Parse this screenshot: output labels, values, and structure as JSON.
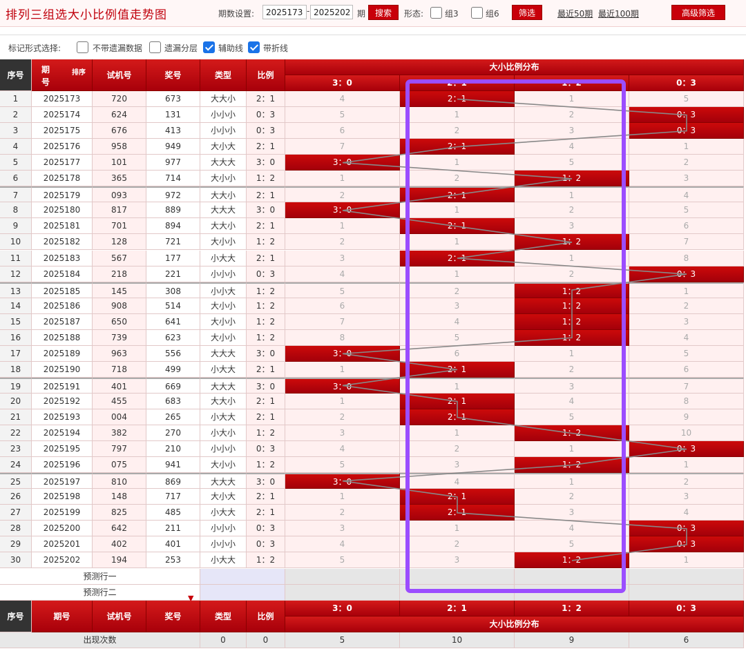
{
  "title": "排列三组选大小比例值走势图",
  "controls": {
    "period_label": "期数设置:",
    "start_value": "2025173",
    "dash": "-",
    "end_value": "2025202",
    "period_suffix": "期",
    "search_label": "搜索",
    "form_label": "形态:",
    "group3_label": "组3",
    "group6_label": "组6",
    "filter_label": "筛选",
    "recent50_label": "最近50期",
    "recent100_label": "最近100期",
    "advanced_label": "高级筛选"
  },
  "options": {
    "label": "标记形式选择:",
    "items": [
      {
        "label": "不带遗漏数据",
        "checked": false
      },
      {
        "label": "遗漏分层",
        "checked": false
      },
      {
        "label": "辅助线",
        "checked": true
      },
      {
        "label": "带折线",
        "checked": true
      }
    ]
  },
  "header": {
    "seq": "序号",
    "period_top": "期",
    "period_bottom": "号",
    "sort": "排序",
    "test": "试机号",
    "prize": "奖号",
    "type": "类型",
    "ratio": "比例",
    "dist_title": "大小比例分布",
    "dist_cols": [
      "3：0",
      "2：1",
      "1：2",
      "0：3"
    ]
  },
  "rows": [
    {
      "seq": "1",
      "period": "2025173",
      "test": "720",
      "prize": "673",
      "type": "大大小",
      "ratio": "2：1",
      "cells": [
        "4",
        "2：1",
        "1",
        "5"
      ],
      "hit": 1
    },
    {
      "seq": "2",
      "period": "2025174",
      "test": "624",
      "prize": "131",
      "type": "小小小",
      "ratio": "0：3",
      "cells": [
        "5",
        "1",
        "2",
        "0：3"
      ],
      "hit": 3
    },
    {
      "seq": "3",
      "period": "2025175",
      "test": "676",
      "prize": "413",
      "type": "小小小",
      "ratio": "0：3",
      "cells": [
        "6",
        "2",
        "3",
        "0：3"
      ],
      "hit": 3
    },
    {
      "seq": "4",
      "period": "2025176",
      "test": "958",
      "prize": "949",
      "type": "大小大",
      "ratio": "2：1",
      "cells": [
        "7",
        "2：1",
        "4",
        "1"
      ],
      "hit": 1
    },
    {
      "seq": "5",
      "period": "2025177",
      "test": "101",
      "prize": "977",
      "type": "大大大",
      "ratio": "3：0",
      "cells": [
        "3：0",
        "1",
        "5",
        "2"
      ],
      "hit": 0
    },
    {
      "seq": "6",
      "period": "2025178",
      "test": "365",
      "prize": "714",
      "type": "大小小",
      "ratio": "1：2",
      "cells": [
        "1",
        "2",
        "1：2",
        "3"
      ],
      "hit": 2
    },
    {
      "seq": "7",
      "period": "2025179",
      "test": "093",
      "prize": "972",
      "type": "大大小",
      "ratio": "2：1",
      "cells": [
        "2",
        "2：1",
        "1",
        "4"
      ],
      "hit": 1
    },
    {
      "seq": "8",
      "period": "2025180",
      "test": "817",
      "prize": "889",
      "type": "大大大",
      "ratio": "3：0",
      "cells": [
        "3：0",
        "1",
        "2",
        "5"
      ],
      "hit": 0
    },
    {
      "seq": "9",
      "period": "2025181",
      "test": "701",
      "prize": "894",
      "type": "大大小",
      "ratio": "2：1",
      "cells": [
        "1",
        "2：1",
        "3",
        "6"
      ],
      "hit": 1
    },
    {
      "seq": "10",
      "period": "2025182",
      "test": "128",
      "prize": "721",
      "type": "大小小",
      "ratio": "1：2",
      "cells": [
        "2",
        "1",
        "1：2",
        "7"
      ],
      "hit": 2
    },
    {
      "seq": "11",
      "period": "2025183",
      "test": "567",
      "prize": "177",
      "type": "小大大",
      "ratio": "2：1",
      "cells": [
        "3",
        "2：1",
        "1",
        "8"
      ],
      "hit": 1
    },
    {
      "seq": "12",
      "period": "2025184",
      "test": "218",
      "prize": "221",
      "type": "小小小",
      "ratio": "0：3",
      "cells": [
        "4",
        "1",
        "2",
        "0：3"
      ],
      "hit": 3
    },
    {
      "seq": "13",
      "period": "2025185",
      "test": "145",
      "prize": "308",
      "type": "小小大",
      "ratio": "1：2",
      "cells": [
        "5",
        "2",
        "1：2",
        "1"
      ],
      "hit": 2
    },
    {
      "seq": "14",
      "period": "2025186",
      "test": "908",
      "prize": "514",
      "type": "大小小",
      "ratio": "1：2",
      "cells": [
        "6",
        "3",
        "1：2",
        "2"
      ],
      "hit": 2
    },
    {
      "seq": "15",
      "period": "2025187",
      "test": "650",
      "prize": "641",
      "type": "大小小",
      "ratio": "1：2",
      "cells": [
        "7",
        "4",
        "1：2",
        "3"
      ],
      "hit": 2
    },
    {
      "seq": "16",
      "period": "2025188",
      "test": "739",
      "prize": "623",
      "type": "大小小",
      "ratio": "1：2",
      "cells": [
        "8",
        "5",
        "1：2",
        "4"
      ],
      "hit": 2
    },
    {
      "seq": "17",
      "period": "2025189",
      "test": "963",
      "prize": "556",
      "type": "大大大",
      "ratio": "3：0",
      "cells": [
        "3：0",
        "6",
        "1",
        "5"
      ],
      "hit": 0
    },
    {
      "seq": "18",
      "period": "2025190",
      "test": "718",
      "prize": "499",
      "type": "小大大",
      "ratio": "2：1",
      "cells": [
        "1",
        "2：1",
        "2",
        "6"
      ],
      "hit": 1
    },
    {
      "seq": "19",
      "period": "2025191",
      "test": "401",
      "prize": "669",
      "type": "大大大",
      "ratio": "3：0",
      "cells": [
        "3：0",
        "1",
        "3",
        "7"
      ],
      "hit": 0
    },
    {
      "seq": "20",
      "period": "2025192",
      "test": "455",
      "prize": "683",
      "type": "大大小",
      "ratio": "2：1",
      "cells": [
        "1",
        "2：1",
        "4",
        "8"
      ],
      "hit": 1
    },
    {
      "seq": "21",
      "period": "2025193",
      "test": "004",
      "prize": "265",
      "type": "小大大",
      "ratio": "2：1",
      "cells": [
        "2",
        "2：1",
        "5",
        "9"
      ],
      "hit": 1
    },
    {
      "seq": "22",
      "period": "2025194",
      "test": "382",
      "prize": "270",
      "type": "小大小",
      "ratio": "1：2",
      "cells": [
        "3",
        "1",
        "1：2",
        "10"
      ],
      "hit": 2
    },
    {
      "seq": "23",
      "period": "2025195",
      "test": "797",
      "prize": "210",
      "type": "小小小",
      "ratio": "0：3",
      "cells": [
        "4",
        "2",
        "1",
        "0：3"
      ],
      "hit": 3
    },
    {
      "seq": "24",
      "period": "2025196",
      "test": "075",
      "prize": "941",
      "type": "大小小",
      "ratio": "1：2",
      "cells": [
        "5",
        "3",
        "1：2",
        "1"
      ],
      "hit": 2
    },
    {
      "seq": "25",
      "period": "2025197",
      "test": "810",
      "prize": "869",
      "type": "大大大",
      "ratio": "3：0",
      "cells": [
        "3：0",
        "4",
        "1",
        "2"
      ],
      "hit": 0
    },
    {
      "seq": "26",
      "period": "2025198",
      "test": "148",
      "prize": "717",
      "type": "大小大",
      "ratio": "2：1",
      "cells": [
        "1",
        "2：1",
        "2",
        "3"
      ],
      "hit": 1
    },
    {
      "seq": "27",
      "period": "2025199",
      "test": "825",
      "prize": "485",
      "type": "小大大",
      "ratio": "2：1",
      "cells": [
        "2",
        "2：1",
        "3",
        "4"
      ],
      "hit": 1
    },
    {
      "seq": "28",
      "period": "2025200",
      "test": "642",
      "prize": "211",
      "type": "小小小",
      "ratio": "0：3",
      "cells": [
        "3",
        "1",
        "4",
        "0：3"
      ],
      "hit": 3
    },
    {
      "seq": "29",
      "period": "2025201",
      "test": "402",
      "prize": "401",
      "type": "小小小",
      "ratio": "0：3",
      "cells": [
        "4",
        "2",
        "5",
        "0：3"
      ],
      "hit": 3
    },
    {
      "seq": "30",
      "period": "2025202",
      "test": "194",
      "prize": "253",
      "type": "小大大",
      "ratio": "1：2",
      "cells": [
        "5",
        "3",
        "1：2",
        "1"
      ],
      "hit": 2
    }
  ],
  "predict": [
    "预测行一",
    "预测行二"
  ],
  "footer": {
    "seq": "序号",
    "period": "期号",
    "test": "试机号",
    "prize": "奖号",
    "type": "类型",
    "ratio": "比例",
    "dist_cols": [
      "3：0",
      "2：1",
      "1：2",
      "0：3"
    ],
    "dist_title": "大小比例分布"
  },
  "stats": {
    "label": "出现次数",
    "type_count": "0",
    "ratio_count": "0",
    "values": [
      "5",
      "10",
      "9",
      "6"
    ]
  },
  "colors": {
    "accent": "#c8000a",
    "highlight_box": "#9b4dff",
    "miss_bg": "#fff0f0",
    "trend_line": "#888888"
  }
}
